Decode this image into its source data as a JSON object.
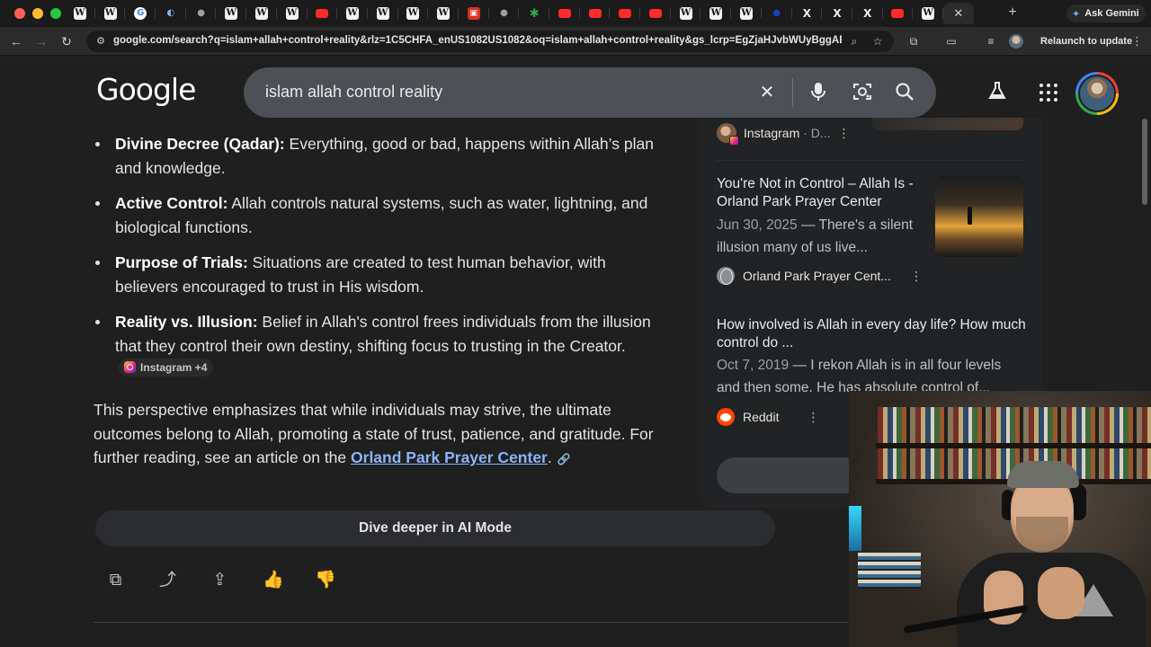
{
  "browser": {
    "tabs": [
      {
        "icon": "wikipedia-icon",
        "glyph": "W"
      },
      {
        "icon": "wikipedia-icon",
        "glyph": "W"
      },
      {
        "icon": "google-icon",
        "glyph": "G"
      },
      {
        "icon": "half-moon-icon",
        "glyph": "◐"
      },
      {
        "icon": "globe-icon",
        "glyph": "●"
      },
      {
        "icon": "wikipedia-icon",
        "glyph": "W"
      },
      {
        "icon": "wikipedia-icon",
        "glyph": "W"
      },
      {
        "icon": "wikipedia-icon",
        "glyph": "W"
      },
      {
        "icon": "youtube-icon",
        "glyph": ""
      },
      {
        "icon": "wikipedia-icon",
        "glyph": "W"
      },
      {
        "icon": "wikipedia-icon",
        "glyph": "W"
      },
      {
        "icon": "wikipedia-icon",
        "glyph": "W"
      },
      {
        "icon": "wikipedia-icon",
        "glyph": "W"
      },
      {
        "icon": "red-square-icon",
        "glyph": "▣"
      },
      {
        "icon": "globe-icon",
        "glyph": "●"
      },
      {
        "icon": "green-star-icon",
        "glyph": "✱"
      },
      {
        "icon": "youtube-icon",
        "glyph": ""
      },
      {
        "icon": "youtube-icon",
        "glyph": ""
      },
      {
        "icon": "youtube-icon",
        "glyph": ""
      },
      {
        "icon": "youtube-icon",
        "glyph": ""
      },
      {
        "icon": "wikipedia-icon",
        "glyph": "W"
      },
      {
        "icon": "wikipedia-icon",
        "glyph": "W"
      },
      {
        "icon": "wikipedia-icon",
        "glyph": "W"
      },
      {
        "icon": "blue-dot-icon",
        "glyph": "●"
      },
      {
        "icon": "x-icon",
        "glyph": "X"
      },
      {
        "icon": "x-icon",
        "glyph": "X"
      },
      {
        "icon": "x-icon",
        "glyph": "X"
      },
      {
        "icon": "youtube-icon",
        "glyph": ""
      },
      {
        "icon": "wikipedia-icon",
        "glyph": "W"
      }
    ],
    "active_tab_close": "✕",
    "new_tab": "+",
    "gemini_label": "Ask Gemini",
    "url": "google.com/search?q=islam+allah+control+reality&rlz=1C5CHFA_enUS1082US1082&oq=islam+allah+control+reality&gs_lcrp=EgZjaHJvbWUyBggAEE...",
    "relaunch_label": "Relaunch to update"
  },
  "google": {
    "logo": "Google",
    "query": "islam allah control reality"
  },
  "overview": {
    "bullets": [
      {
        "term": "Divine Decree (Qadar):",
        "text": " Everything, good or bad, happens within Allah’s plan and knowledge."
      },
      {
        "term": "Active Control:",
        "text": " Allah controls natural systems, such as water, lightning, and biological functions."
      },
      {
        "term": "Purpose of Trials:",
        "text": " Situations are created to test human behavior, with believers encouraged to trust in His wisdom."
      },
      {
        "term": "Reality vs. Illusion:",
        "text": " Belief in Allah's control frees individuals from the illusion that they control their own destiny, shifting focus to trusting in the Creator."
      }
    ],
    "citation_chip": "Instagram +4",
    "paragraph_text": "This perspective emphasizes that while individuals may strive, the ultimate outcomes belong to Allah, promoting a state of trust, patience, and gratitude. For further reading, see an article on the ",
    "paragraph_link": "Orland Park Prayer Center",
    "paragraph_end": ".",
    "dive_deeper": "Dive deeper in AI Mode"
  },
  "sources": {
    "top_source": {
      "name": "Instagram",
      "suffix": " · D..."
    },
    "cards": [
      {
        "title": "You're Not in Control – Allah Is - Orland Park Prayer Center",
        "date": "Jun 30, 2025",
        "snippet": " — There's a silent illusion many of us live...",
        "source": "Orland Park Prayer Cent..."
      },
      {
        "title": "How involved is Allah in every day life? How much control do ...",
        "date": "Oct 7, 2019",
        "snippet": " — I rekon Allah is in all four levels and then some. He has absolute control of...",
        "source": "Reddit"
      }
    ],
    "show_all_visible": "S"
  },
  "colors": {
    "background": "#1f1f1f",
    "link": "#8ab4f8",
    "searchbox": "#4d5156",
    "traffic_red": "#ff5f57",
    "traffic_yellow": "#febc2e",
    "traffic_green": "#28c840"
  }
}
